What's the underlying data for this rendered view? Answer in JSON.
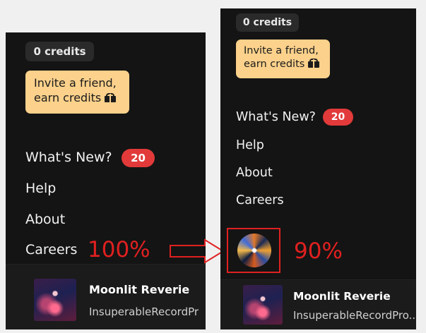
{
  "left": {
    "credits": "0 credits",
    "invite_line1": "Invite a friend,",
    "invite_line2": "earn credits",
    "menu": [
      "What's New?",
      "Help",
      "About",
      "Careers"
    ],
    "badge": "20",
    "song_title": "Moonlit Reverie",
    "artist": "InsuperableRecordPr"
  },
  "right": {
    "credits": "0 credits",
    "invite_line1": "Invite a friend,",
    "invite_line2": "earn credits",
    "menu": [
      "What's New?",
      "Help",
      "About",
      "Careers"
    ],
    "badge": "20",
    "song_title": "Moonlit Reverie",
    "artist": "InsuperableRecordPro..."
  },
  "annotations": {
    "left_zoom": "100%",
    "right_zoom": "90%"
  },
  "colors": {
    "panel_bg": "#141414",
    "invite_bg": "#fbd18b",
    "badge_bg": "#e23a3a",
    "annotation_red": "#e02020"
  },
  "icons": [
    "gift-icon",
    "arrow-right-icon"
  ]
}
